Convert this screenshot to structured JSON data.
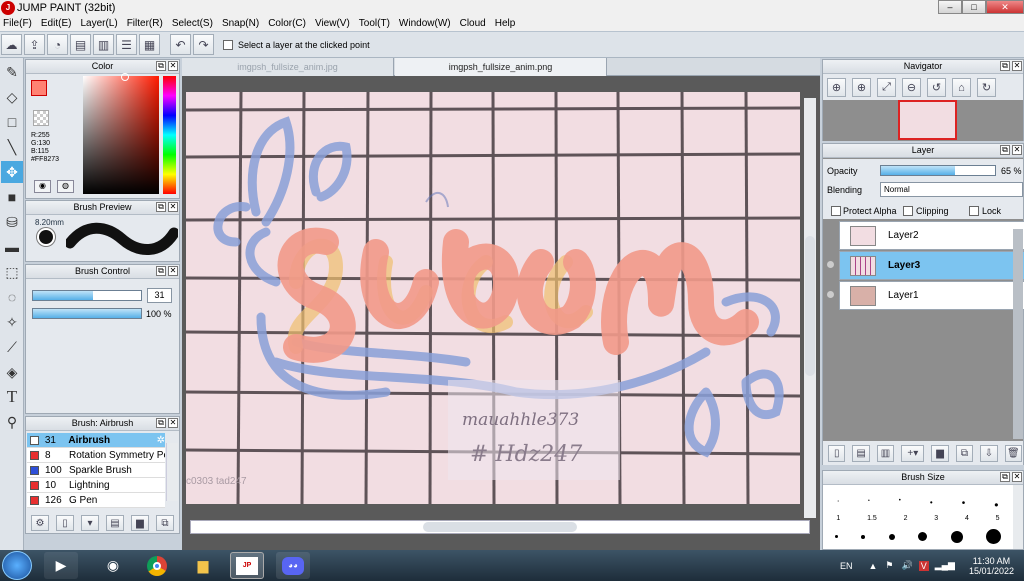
{
  "window": {
    "title": "JUMP PAINT (32bit)",
    "app_icon": "jump-paint-logo"
  },
  "menu": [
    "File(F)",
    "Edit(E)",
    "Layer(L)",
    "Filter(R)",
    "Select(S)",
    "Snap(N)",
    "Color(C)",
    "View(V)",
    "Tool(T)",
    "Window(W)",
    "Cloud",
    "Help"
  ],
  "toolbar": {
    "select_layer_label": "Select a layer at the clicked point"
  },
  "color_panel": {
    "title": "Color",
    "r": "R:255",
    "g": "G:130",
    "b": "B:115",
    "hex": "#FF8273",
    "current_color": "#FF8273"
  },
  "brush_preview": {
    "title": "Brush Preview",
    "size": "8.20mm"
  },
  "brush_control": {
    "title": "Brush Control",
    "size_value": "31",
    "opacity_value": "100 %",
    "size_fraction": 0.56,
    "opacity_fraction": 1.0
  },
  "brush_list": {
    "title": "Brush: Airbrush",
    "items": [
      {
        "num": "31",
        "name": "Airbrush",
        "color": "#ffffff",
        "selected": true
      },
      {
        "num": "8",
        "name": "Rotation Symmetry Pen",
        "color": "#e83030",
        "selected": false
      },
      {
        "num": "100",
        "name": "Sparkle Brush",
        "color": "#2e4fd8",
        "selected": false
      },
      {
        "num": "10",
        "name": "Lightning",
        "color": "#e83030",
        "selected": false
      },
      {
        "num": "126",
        "name": "G Pen",
        "color": "#e83030",
        "selected": false
      }
    ]
  },
  "tabs": [
    {
      "label": "imgpsh_fullsize_anim.jpg",
      "active": false
    },
    {
      "label": "imgpsh_fullsize_anim.png",
      "active": true
    }
  ],
  "canvas": {
    "watermark_1": "mauahhle373",
    "watermark_2": "# Hdz247",
    "corner_text": "c0303 tad247"
  },
  "navigator": {
    "title": "Navigator"
  },
  "layer_panel": {
    "title": "Layer",
    "opacity_label": "Opacity",
    "opacity_value": "65 %",
    "opacity_fraction": 0.65,
    "blending_label": "Blending",
    "blending_value": "Normal",
    "protect_alpha": "Protect Alpha",
    "clipping": "Clipping",
    "lock": "Lock",
    "layers": [
      {
        "name": "Layer2",
        "selected": false
      },
      {
        "name": "Layer3",
        "selected": true
      },
      {
        "name": "Layer1",
        "selected": false
      }
    ]
  },
  "brush_size_panel": {
    "title": "Brush Size",
    "sizes": [
      "1",
      "1.5",
      "2",
      "3",
      "4",
      "5"
    ]
  },
  "taskbar": {
    "lang": "EN",
    "time": "11:30 AM",
    "date": "15/01/2022"
  }
}
